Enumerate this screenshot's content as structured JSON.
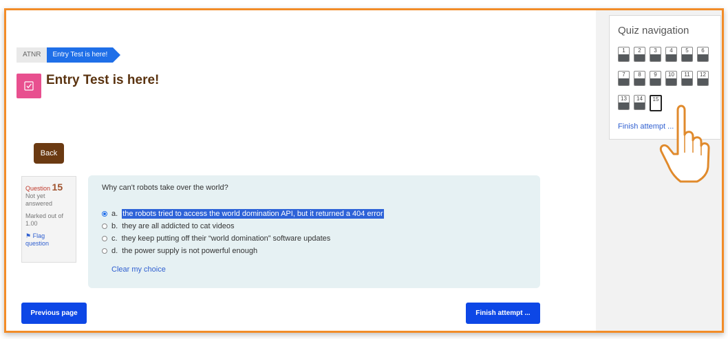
{
  "breadcrumb": {
    "root": "ATNR",
    "current": "Entry Test is here!"
  },
  "page": {
    "title": "Entry Test is here!"
  },
  "back_label": "Back",
  "question_info": {
    "label": "Question",
    "number": "15",
    "status_line1": "Not yet",
    "status_line2": "answered",
    "marks_line1": "Marked out of",
    "marks_line2": "1.00",
    "flag_line1": "Flag",
    "flag_line2": "question"
  },
  "question": {
    "text": "Why can't robots take over the world?",
    "answers": [
      {
        "letter": "a.",
        "text": "the robots tried to access the world domination API, but it returned a 404 error",
        "selected": true
      },
      {
        "letter": "b.",
        "text": "they are all addicted to cat videos",
        "selected": false
      },
      {
        "letter": "c.",
        "text": "they keep putting off their “world domination” software updates",
        "selected": false
      },
      {
        "letter": "d.",
        "text": "the power supply is not powerful enough",
        "selected": false
      }
    ],
    "clear_label": "Clear my choice"
  },
  "buttons": {
    "previous": "Previous page",
    "finish": "Finish attempt ..."
  },
  "quiz_nav": {
    "title": "Quiz navigation",
    "questions": [
      "1",
      "2",
      "3",
      "4",
      "5",
      "6",
      "7",
      "8",
      "9",
      "10",
      "11",
      "12",
      "13",
      "14",
      "15"
    ],
    "current": "15",
    "finish_link": "Finish attempt ..."
  },
  "colors": {
    "frame_border": "#f28c28",
    "breadcrumb_active": "#1f6fe8",
    "title": "#5a3310",
    "back_button": "#6b3a12",
    "primary_button": "#0d47e6",
    "question_bg": "#e6f1f3",
    "page_icon": "#e8508f"
  },
  "icons": {
    "page": "quiz-check-icon",
    "flag": "flag-icon",
    "cursor": "pointing-hand-icon"
  }
}
